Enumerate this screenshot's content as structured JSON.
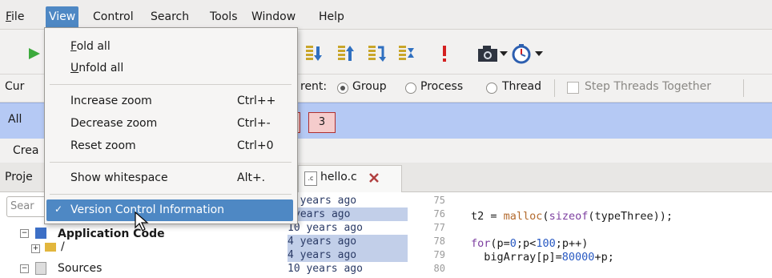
{
  "menubar": [
    "File",
    "View",
    "Control",
    "Search",
    "Tools",
    "Window",
    "Help"
  ],
  "view_menu": {
    "fold_all": "Fold all",
    "unfold_all": "Unfold all",
    "increase_zoom": {
      "label": "Increase zoom",
      "accel": "Ctrl++"
    },
    "decrease_zoom": {
      "label": "Decrease zoom",
      "accel": "Ctrl+-"
    },
    "reset_zoom": {
      "label": "Reset zoom",
      "accel": "Ctrl+0"
    },
    "show_whitespace": {
      "label": "Show whitespace",
      "accel": "Alt+."
    },
    "version_control": {
      "label": "Version Control Information",
      "check": "✓"
    }
  },
  "focus_row": {
    "left_label": "Cur",
    "focus_prefix": "rent:",
    "group": "Group",
    "process": "Process",
    "thread": "Thread",
    "step_threads": "Step Threads Together"
  },
  "group_row": {
    "label": "All",
    "box": "3"
  },
  "create_row": {
    "label": "Crea"
  },
  "tabs": {
    "project": "Proje",
    "file": "hello.c",
    "file_icon": ".c"
  },
  "search": {
    "placeholder": "Sear"
  },
  "tree": {
    "root": "Application Code",
    "child_root": "/",
    "sources": "Sources"
  },
  "version_column": [
    "0 years ago",
    "years ago",
    "10 years ago",
    "4 years ago",
    "4 years ago",
    "10 years ago"
  ],
  "line_numbers": [
    "75",
    "76",
    "77",
    "78",
    "79",
    "80"
  ],
  "code": {
    "l76_a": "t2 = ",
    "l76_fn": "malloc",
    "l76_b": "(",
    "l76_kw": "sizeof",
    "l76_c": "(typeThree));",
    "l78_kw": "for",
    "l78_a": "(p=",
    "l78_n1": "0",
    "l78_b": ";p<",
    "l78_n2": "100",
    "l78_c": ";p++)",
    "l79_a": "  bigArray[p]=",
    "l79_n": "80000",
    "l79_b": "+p;"
  },
  "colors": {
    "menu_highlight": "#4e88c4",
    "group_row": "#b5c9f4",
    "process_box": "#f5cccc"
  }
}
